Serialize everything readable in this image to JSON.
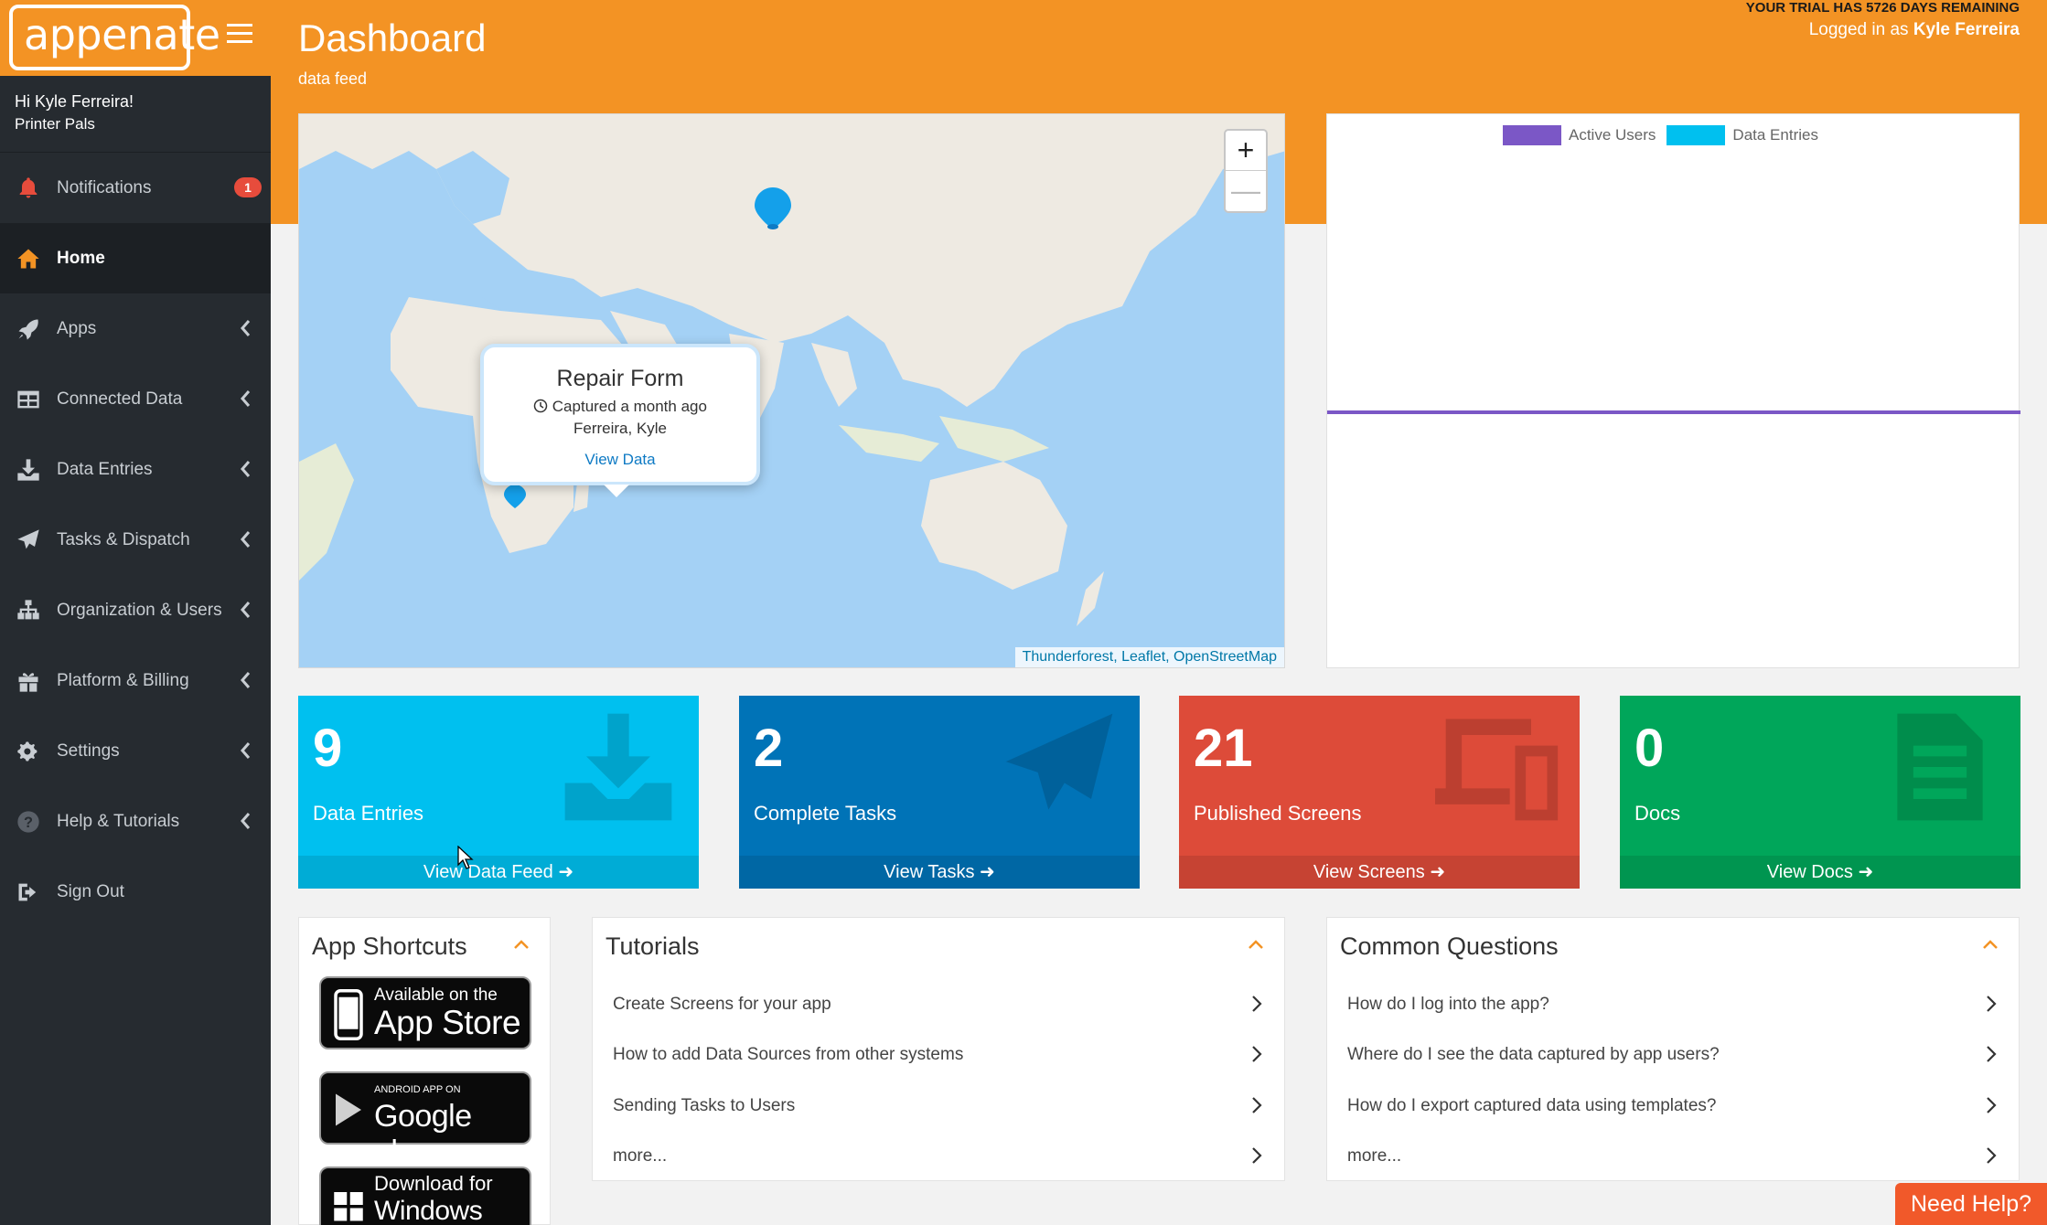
{
  "brand": {
    "logo_text": "appenate"
  },
  "user": {
    "greeting": "Hi Kyle Ferreira!",
    "company": "Printer Pals"
  },
  "sidebar": {
    "items": [
      {
        "label": "Notifications",
        "badge": "1"
      },
      {
        "label": "Home"
      },
      {
        "label": "Apps"
      },
      {
        "label": "Connected Data"
      },
      {
        "label": "Data Entries"
      },
      {
        "label": "Tasks & Dispatch"
      },
      {
        "label": "Organization & Users"
      },
      {
        "label": "Platform & Billing"
      },
      {
        "label": "Settings"
      },
      {
        "label": "Help & Tutorials"
      },
      {
        "label": "Sign Out"
      }
    ]
  },
  "header": {
    "title": "Dashboard",
    "subtitle": "data feed",
    "trial": "YOUR TRIAL HAS 5726 DAYS REMAINING",
    "logged_prefix": "Logged in as ",
    "logged_user": "Kyle Ferreira"
  },
  "map": {
    "zoom_in": "+",
    "zoom_out": "—",
    "attribution": {
      "a": "Thunderforest",
      "sep1": ", ",
      "b": "Leaflet",
      "sep2": ", ",
      "c": "OpenStreetMap"
    },
    "popup": {
      "title": "Repair Form",
      "captured": "Captured a month ago",
      "user": "Ferreira, Kyle",
      "link": "View Data"
    }
  },
  "chart": {
    "legend": [
      {
        "name": "Active Users",
        "color": "#7b57c6"
      },
      {
        "name": "Data Entries",
        "color": "#00c0ef"
      }
    ]
  },
  "stats": [
    {
      "value": "9",
      "label": "Data Entries",
      "link": "View Data Feed",
      "color": "#00c0ef"
    },
    {
      "value": "2",
      "label": "Complete Tasks",
      "link": "View Tasks",
      "color": "#0073b7"
    },
    {
      "value": "21",
      "label": "Published Screens",
      "link": "View Screens",
      "color": "#dd4b39"
    },
    {
      "value": "0",
      "label": "Docs",
      "link": "View Docs",
      "color": "#00a65a"
    }
  ],
  "shortcuts": {
    "title": "App Shortcuts",
    "apple": {
      "small": "Available on the",
      "big": "App Store"
    },
    "google": {
      "small": "ANDROID APP ON",
      "big": "Google play"
    },
    "windows": {
      "small": "Download for",
      "big": "Windows"
    }
  },
  "tutorials": {
    "title": "Tutorials",
    "items": [
      "Create Screens for your app",
      "How to add Data Sources from other systems",
      "Sending Tasks to Users",
      "more..."
    ]
  },
  "questions": {
    "title": "Common Questions",
    "items": [
      "How do I log into the app?",
      "Where do I see the data captured by app users?",
      "How do I export captured data using templates?",
      "more..."
    ]
  },
  "help_button": "Need Help?"
}
